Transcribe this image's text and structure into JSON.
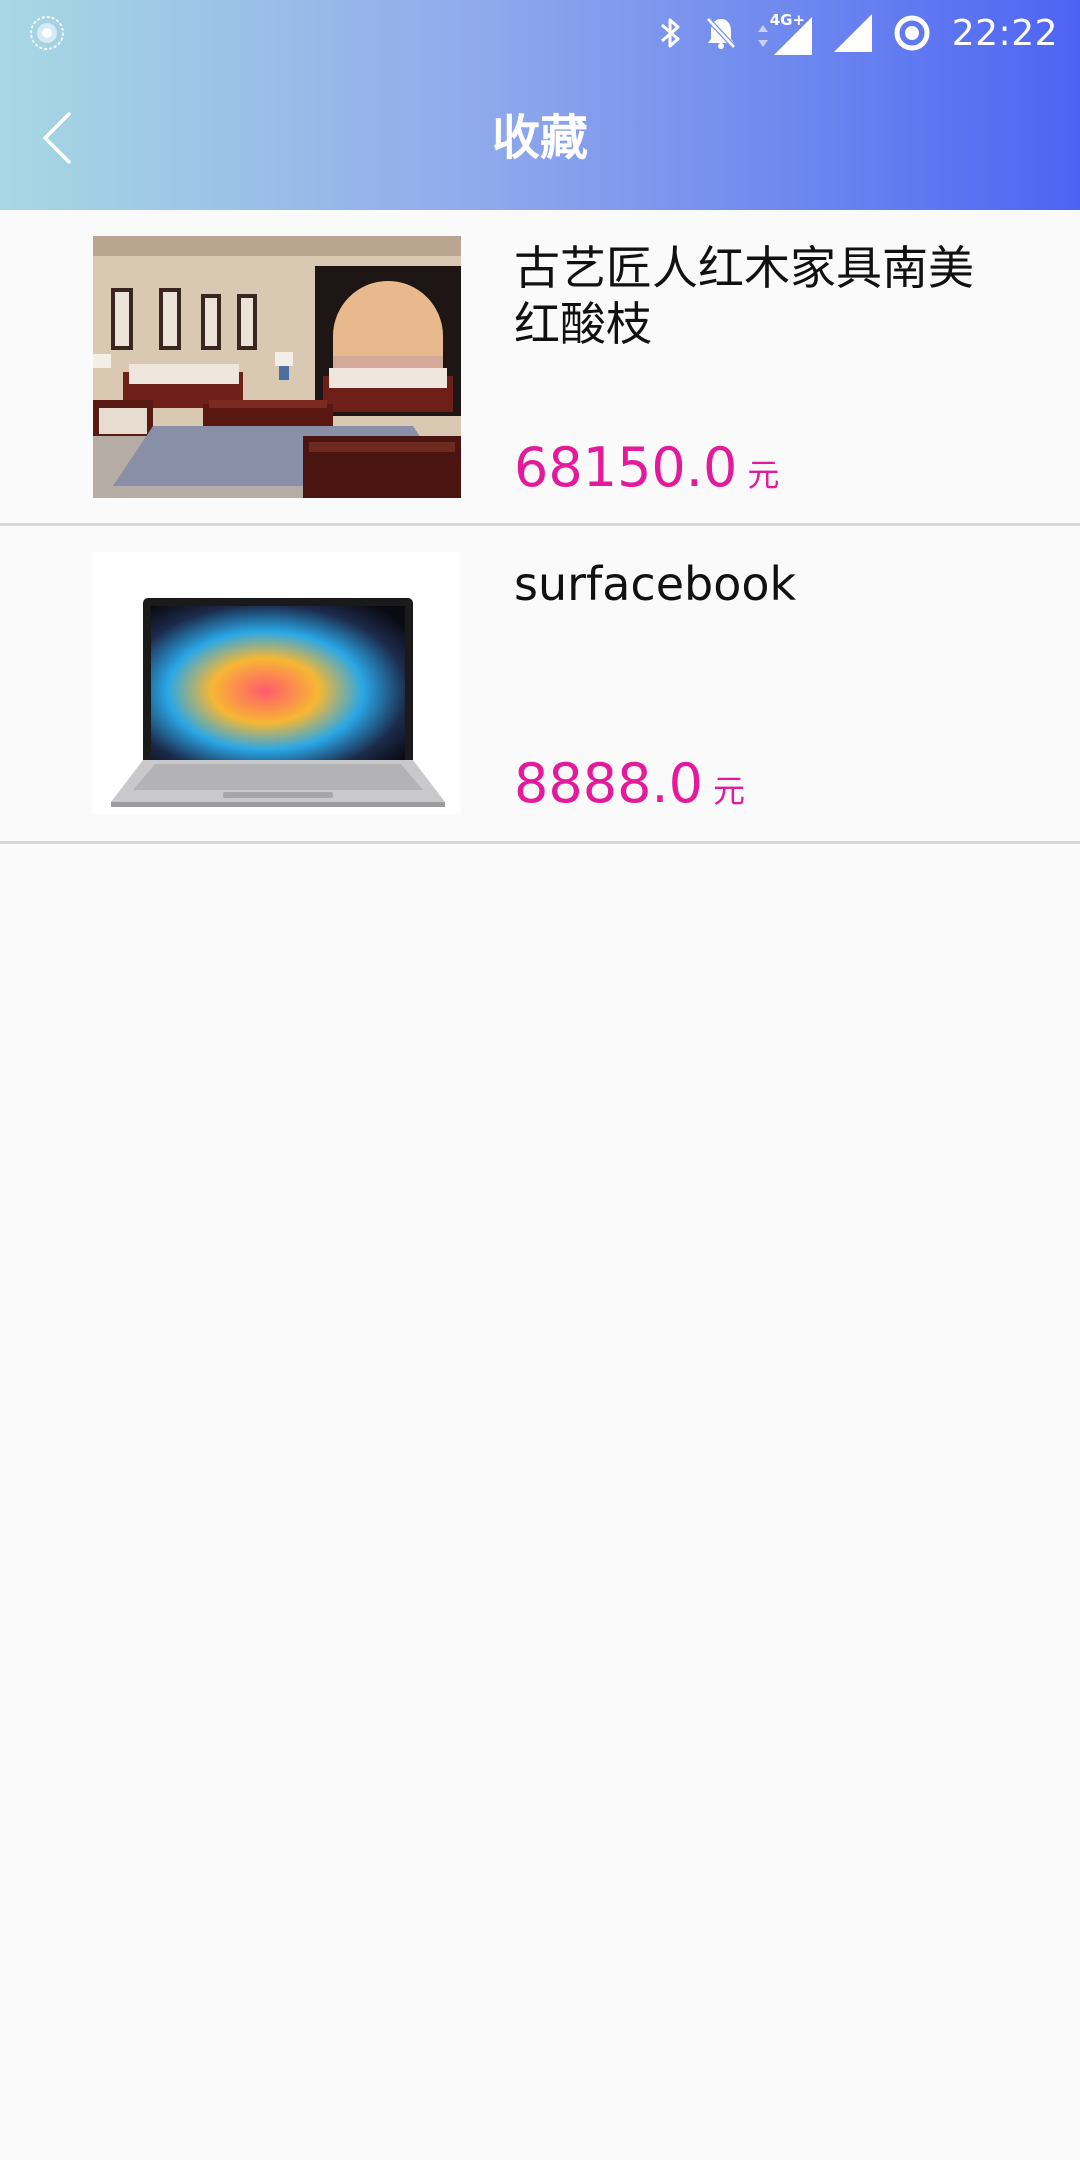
{
  "status_bar": {
    "time": "22:22",
    "network_label": "4G+",
    "icons": [
      "app-notification-icon",
      "bluetooth-icon",
      "notifications-off-icon",
      "data-arrows-icon",
      "signal-icon",
      "signal-icon-2",
      "sync-icon"
    ]
  },
  "header": {
    "title": "收藏",
    "back_icon": "chevron-left-icon",
    "gradient": [
      "#a7d8e3",
      "#4e63f3"
    ]
  },
  "favorites": [
    {
      "name": "古艺匠人红木家具南美红酸枝",
      "price": "68150.0",
      "unit": "元",
      "image": "living-room-furniture-photo"
    },
    {
      "name": "surfacebook",
      "price": "8888.0",
      "unit": "元",
      "image": "laptop-photo"
    }
  ],
  "colors": {
    "price": "#e31a9c",
    "divider": "#d6d6d6",
    "background": "#fafafa"
  }
}
